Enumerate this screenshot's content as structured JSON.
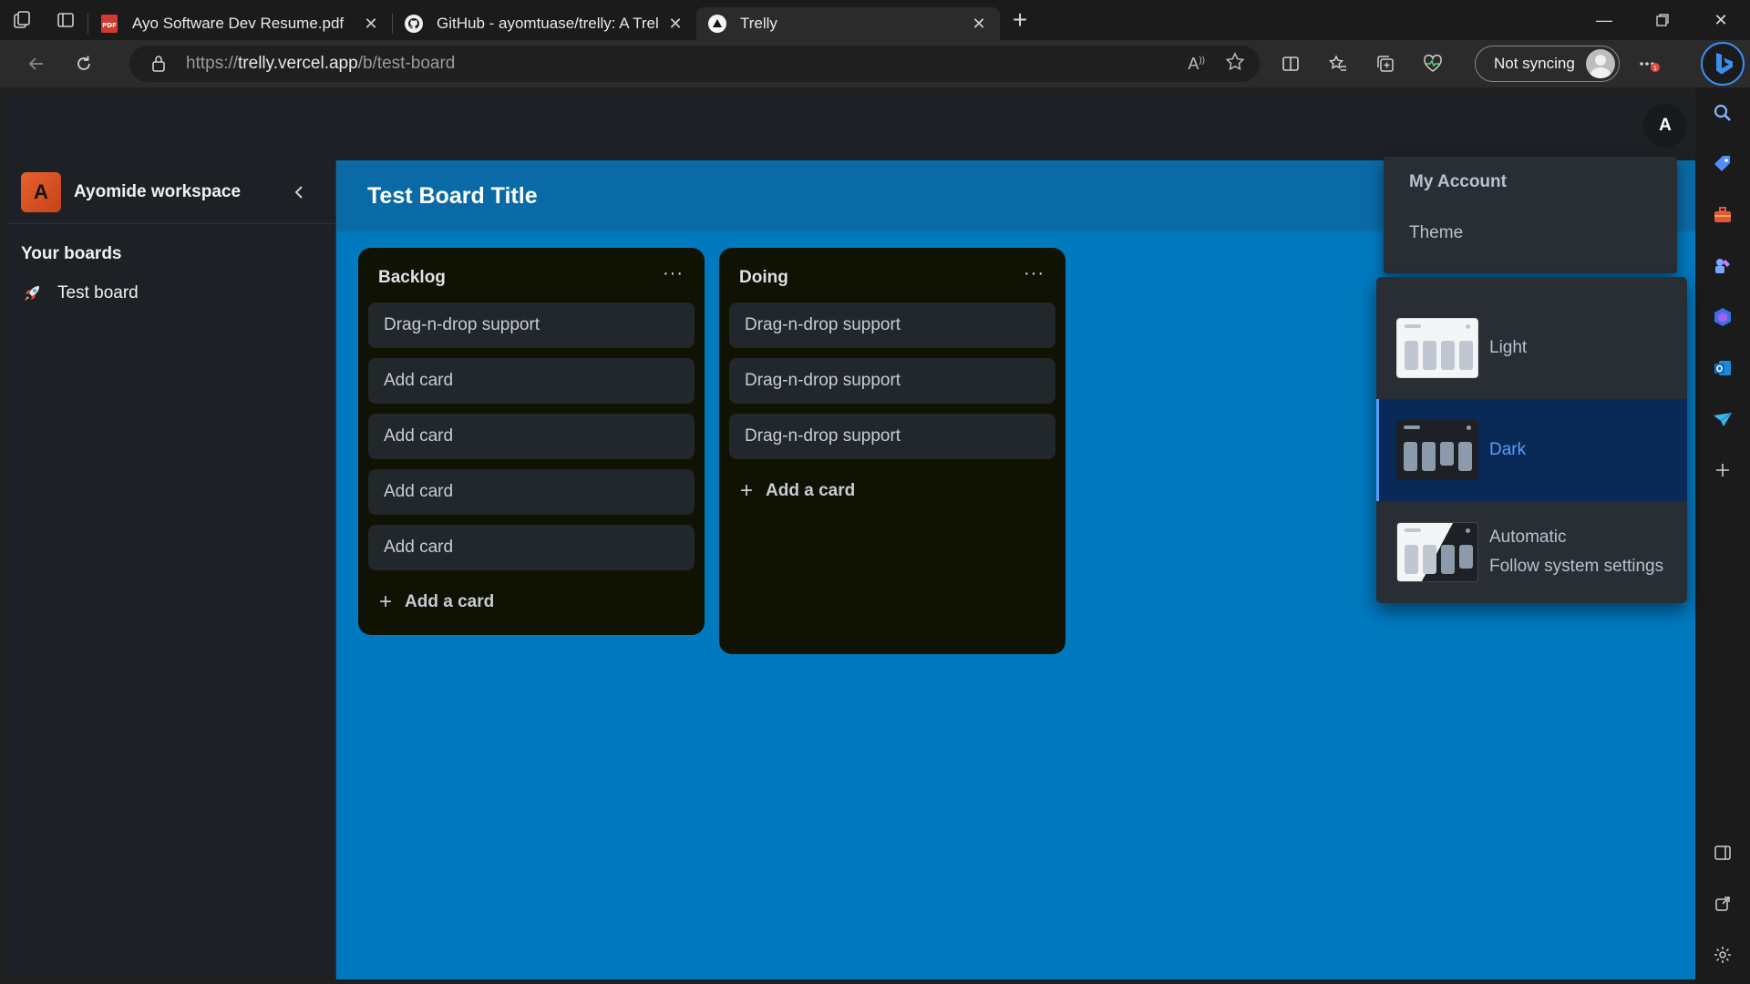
{
  "browser": {
    "tabs": [
      {
        "title": "Ayo Software Dev Resume.pdf",
        "icon": "pdf-icon"
      },
      {
        "title": "GitHub - ayomtuase/trelly: A Trel",
        "icon": "github-icon"
      },
      {
        "title": "Trelly",
        "icon": "trelly-icon"
      }
    ],
    "url_prefix": "https://",
    "url_host": "trelly.vercel.app",
    "url_path": "/b/test-board",
    "sync_label": "Not syncing"
  },
  "app": {
    "user_initial": "A",
    "workspace": {
      "initial": "A",
      "name": "Ayomide workspace"
    },
    "boards_heading": "Your boards",
    "boards": [
      {
        "emoji": "rocket",
        "name": "Test board"
      }
    ],
    "board_title": "Test Board Title",
    "lists": [
      {
        "title": "Backlog",
        "menu": "···",
        "cards": [
          "Drag-n-drop support",
          "Add card",
          "Add card",
          "Add card",
          "Add card"
        ],
        "add_label": "Add a card"
      },
      {
        "title": "Doing",
        "menu": "···",
        "cards": [
          "Drag-n-drop support",
          "Drag-n-drop support",
          "Drag-n-drop support"
        ],
        "add_label": "Add a card"
      }
    ],
    "account_menu": {
      "title": "My Account",
      "theme": "Theme"
    },
    "theme_menu": {
      "options": [
        {
          "label": "Light",
          "sub": ""
        },
        {
          "label": "Dark",
          "sub": "",
          "selected": true
        },
        {
          "label": "Automatic",
          "sub": "Follow system settings"
        }
      ]
    }
  },
  "colors": {
    "board_bg": "#0079bf",
    "list_bg": "#101204",
    "card_bg": "#22272b",
    "selected_bg": "#092957",
    "accent": "#579dff",
    "workspace_logo": "#e8622c"
  }
}
